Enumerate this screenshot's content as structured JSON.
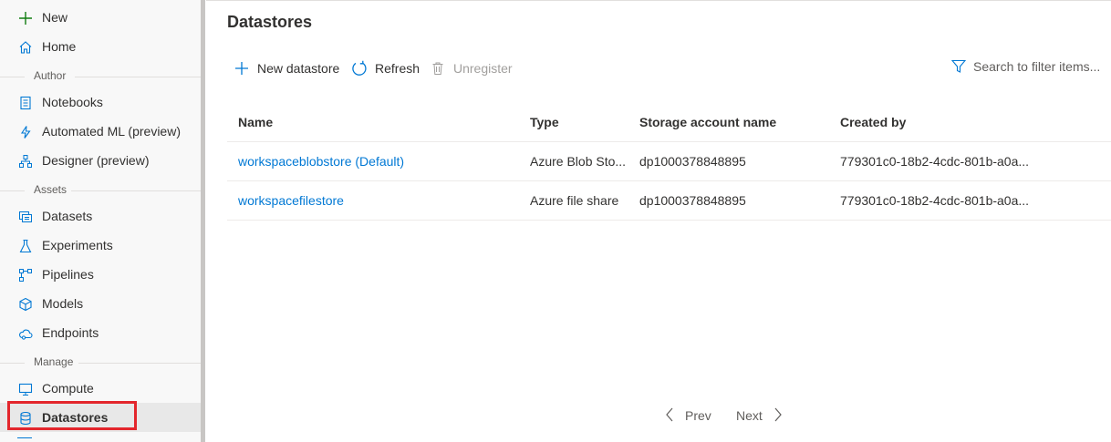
{
  "sidebar": {
    "new_label": "New",
    "home_label": "Home",
    "author_header": "Author",
    "notebooks_label": "Notebooks",
    "automl_label": "Automated ML (preview)",
    "designer_label": "Designer (preview)",
    "assets_header": "Assets",
    "datasets_label": "Datasets",
    "experiments_label": "Experiments",
    "pipelines_label": "Pipelines",
    "models_label": "Models",
    "endpoints_label": "Endpoints",
    "manage_header": "Manage",
    "compute_label": "Compute",
    "datastores_label": "Datastores"
  },
  "main": {
    "title": "Datastores",
    "toolbar": {
      "new_label": "New datastore",
      "refresh_label": "Refresh",
      "unregister_label": "Unregister"
    },
    "search_placeholder": "Search to filter items...",
    "columns": [
      "Name",
      "Type",
      "Storage account name",
      "Created by"
    ],
    "rows": [
      {
        "name": "workspaceblobstore (Default)",
        "type": "Azure Blob Sto...",
        "account": "dp1000378848895",
        "created_by": "779301c0-18b2-4cdc-801b-a0a..."
      },
      {
        "name": "workspacefilestore",
        "type": "Azure file share",
        "account": "dp1000378848895",
        "created_by": "779301c0-18b2-4cdc-801b-a0a..."
      }
    ],
    "pager": {
      "prev_label": "Prev",
      "next_label": "Next"
    }
  },
  "colors": {
    "accent": "#0078d4",
    "highlight": "#e3262c",
    "new_icon": "#107c10"
  }
}
